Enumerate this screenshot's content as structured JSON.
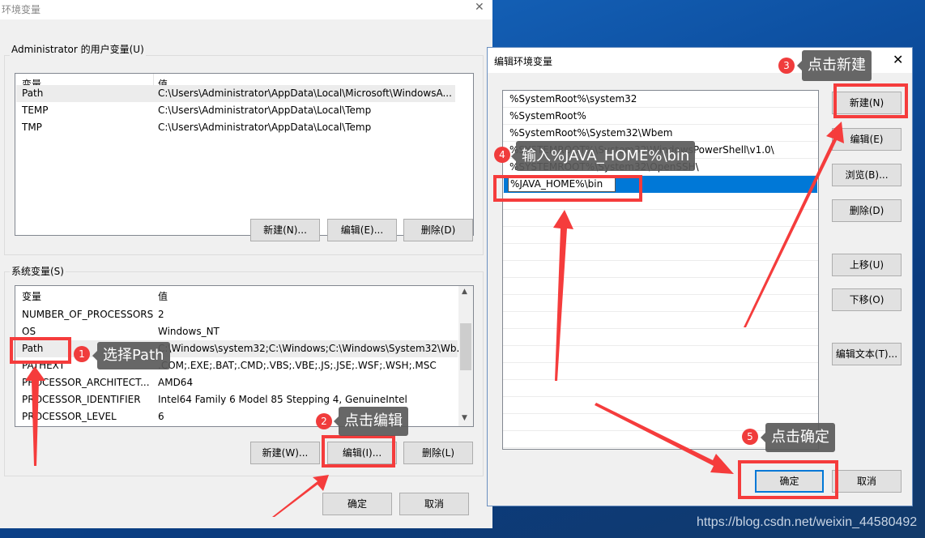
{
  "env_dialog": {
    "title": "环境变量",
    "close": "✕",
    "user_group": {
      "label": "Administrator 的用户变量(U)",
      "header": [
        "变量",
        "值"
      ],
      "rows": [
        [
          "Path",
          "C:\\Users\\Administrator\\AppData\\Local\\Microsoft\\WindowsA..."
        ],
        [
          "TEMP",
          "C:\\Users\\Administrator\\AppData\\Local\\Temp"
        ],
        [
          "TMP",
          "C:\\Users\\Administrator\\AppData\\Local\\Temp"
        ]
      ],
      "buttons": [
        "新建(N)...",
        "编辑(E)...",
        "删除(D)"
      ]
    },
    "system_group": {
      "label": "系统变量(S)",
      "header": [
        "变量",
        "值"
      ],
      "rows": [
        [
          "NUMBER_OF_PROCESSORS",
          "2"
        ],
        [
          "OS",
          "Windows_NT"
        ],
        [
          "Path",
          "C:\\Windows\\system32;C:\\Windows;C:\\Windows\\System32\\Wb..."
        ],
        [
          "PATHEXT",
          ".COM;.EXE;.BAT;.CMD;.VBS;.VBE;.JS;.JSE;.WSF;.WSH;.MSC"
        ],
        [
          "PROCESSOR_ARCHITECT...",
          "AMD64"
        ],
        [
          "PROCESSOR_IDENTIFIER",
          "Intel64 Family 6 Model 85 Stepping 4, GenuineIntel"
        ],
        [
          "PROCESSOR_LEVEL",
          "6"
        ]
      ],
      "buttons": [
        "新建(W)...",
        "编辑(I)...",
        "删除(L)"
      ]
    },
    "ok": "确定",
    "cancel": "取消"
  },
  "edit_dialog": {
    "title": "编辑环境变量",
    "close": "✕",
    "entries": [
      "%SystemRoot%\\system32",
      "%SystemRoot%",
      "%SystemRoot%\\System32\\Wbem",
      "%SYSTEMROOT%\\System32\\WindowsPowerShell\\v1.0\\",
      "%SYSTEMROOT%\\System32\\OpenSSH\\"
    ],
    "editing_value": "%JAVA_HOME%\\bin",
    "buttons": [
      "新建(N)",
      "编辑(E)",
      "浏览(B)...",
      "删除(D)",
      "上移(U)",
      "下移(O)",
      "编辑文本(T)..."
    ],
    "ok": "确定",
    "cancel": "取消"
  },
  "annotations": [
    {
      "step": "1",
      "text": "选择Path"
    },
    {
      "step": "2",
      "text": "点击编辑"
    },
    {
      "step": "3",
      "text": "点击新建"
    },
    {
      "step": "4",
      "text": "输入%JAVA_HOME%\\bin"
    },
    {
      "step": "5",
      "text": "点击确定"
    }
  ],
  "watermark": "https://blog.csdn.net/weixin_44580492",
  "colors": {
    "annotation_red": "#f53c3c",
    "selection_blue": "#0078d7",
    "desktop_blue": "#0d4fa0"
  }
}
